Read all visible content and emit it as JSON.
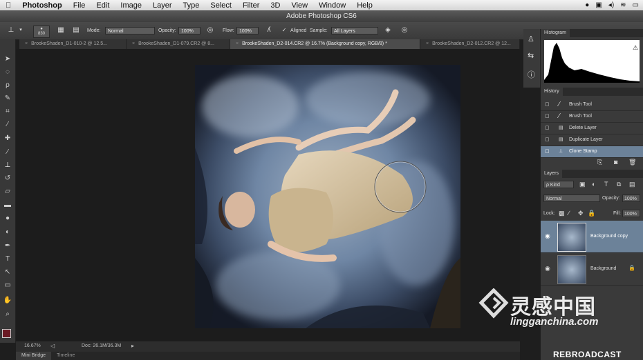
{
  "menubar": {
    "app": "Photoshop",
    "items": [
      "File",
      "Edit",
      "Image",
      "Layer",
      "Type",
      "Select",
      "Filter",
      "3D",
      "View",
      "Window",
      "Help"
    ]
  },
  "window": {
    "title": "Adobe Photoshop CS6"
  },
  "options": {
    "brush_size": "830",
    "mode_label": "Mode:",
    "mode_value": "Normal",
    "opacity_label": "Opacity:",
    "opacity_value": "100%",
    "flow_label": "Flow:",
    "flow_value": "100%",
    "aligned_label": "Aligned",
    "sample_label": "Sample:",
    "sample_value": "All Layers"
  },
  "doc_tabs": [
    "BrookeShaden_D1-010-2 @ 12.5...",
    "BrookeShaden_D1-079.CR2 @ 8...",
    "BrookeShaden_D2-014.CR2 @ 16.7% (Background copy, RGB/8) *",
    "BrookeShaden_D2-012.CR2 @ 12..."
  ],
  "status": {
    "zoom": "16.67%",
    "doc": "Doc: 26.1M/36.3M"
  },
  "bottom_tabs": [
    "Mini Bridge",
    "Timeline"
  ],
  "histogram": {
    "title": "Histogram",
    "warning": "⚠"
  },
  "history": {
    "title": "History",
    "items": [
      "Brush Tool",
      "Brush Tool",
      "Delete Layer",
      "Duplicate Layer",
      "Clone Stamp"
    ],
    "active_index": 4
  },
  "layers": {
    "title": "Layers",
    "filter": "ρ Kind",
    "blend_mode": "Normal",
    "opacity_label": "Opacity:",
    "opacity_value": "100%",
    "lock_label": "Lock:",
    "fill_label": "Fill:",
    "fill_value": "100%",
    "items": [
      {
        "name": "Background copy",
        "active": true
      },
      {
        "name": "Background",
        "active": false
      }
    ]
  },
  "watermark": {
    "brand": "灵感中国",
    "site": "lingganchina.com",
    "tag": "REBROADCAST"
  },
  "colors": {
    "accent_selected": "#6c8299",
    "foreground_swatch": "#6b1a24"
  }
}
